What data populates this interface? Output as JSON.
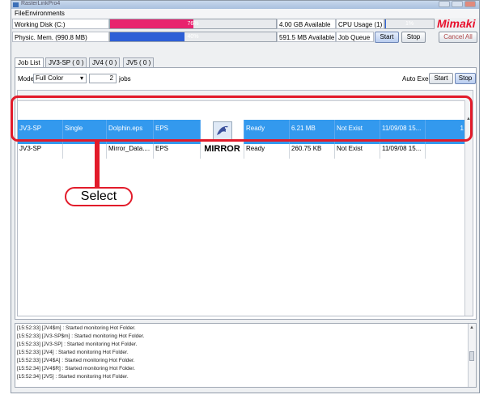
{
  "window": {
    "title": "RasterLinkPro4"
  },
  "menu": [
    "File",
    "Environments"
  ],
  "status": {
    "disk_label": "Working Disk (C:)",
    "disk_percent": "76%",
    "disk_fraction": 0.5,
    "disk_available": "4.00 GB Available",
    "cpu_label": "CPU Usage (1)",
    "cpu_percent": "1%",
    "cpu_fraction": 0.02,
    "mem_label": "Physic. Mem. (990.8 MB)",
    "mem_percent": "40%",
    "mem_fraction": 0.45,
    "mem_available": "591.5 MB Available",
    "job_queue_label": "Job Queue",
    "start_label": "Start",
    "stop_label": "Stop",
    "cancel_all_label": "Cancel All"
  },
  "brand": {
    "logo_text": "Mimaki",
    "accent_color": "#e8102c"
  },
  "tabs": [
    "Job List",
    "JV3-SP ( 0 )",
    "JV4 ( 0 )",
    "JV5 ( 0 )"
  ],
  "toolbar": {
    "mode_label": "Mode",
    "mode_value": "Full Color",
    "jobs_count": "2",
    "jobs_suffix": "jobs",
    "auto_execution_label": "Auto Execution",
    "start_label": "Start",
    "stop_label": "Stop"
  },
  "jobs": [
    {
      "printer": "JV3-SP",
      "type": "Single",
      "file": "Dolphin.eps",
      "format": "EPS",
      "preview_icon": "dolphin-thumbnail",
      "status": "Ready",
      "size": "6.21 MB",
      "exist": "Not Exist",
      "date": "11/09/08 15...",
      "count": "1",
      "selected": true
    },
    {
      "printer": "JV3-SP",
      "type": "",
      "file": "Mirror_Data....",
      "format": "EPS",
      "preview_text": "MIRROR",
      "status": "Ready",
      "size": "260.75 KB",
      "exist": "Not Exist",
      "date": "11/09/08 15...",
      "count": "",
      "selected": false
    }
  ],
  "log": [
    "[15:52:33] [JV4$m] : Started monitoring Hot Folder.",
    "[15:52:33] [JV3-SP$m] : Started monitoring Hot Folder.",
    "[15:52:33] [JV3-SP] : Started monitoring Hot Folder.",
    "[15:52:33] [JV4] : Started monitoring Hot Folder.",
    "[15:52:33] [JV4$A] : Started monitoring Hot Folder.",
    "[15:52:34] [JV4$R] : Started monitoring Hot Folder.",
    "[15:52:34] [JV5] : Started monitoring Hot Folder."
  ],
  "annotation": {
    "label": "Select",
    "color": "#e21b2a"
  }
}
